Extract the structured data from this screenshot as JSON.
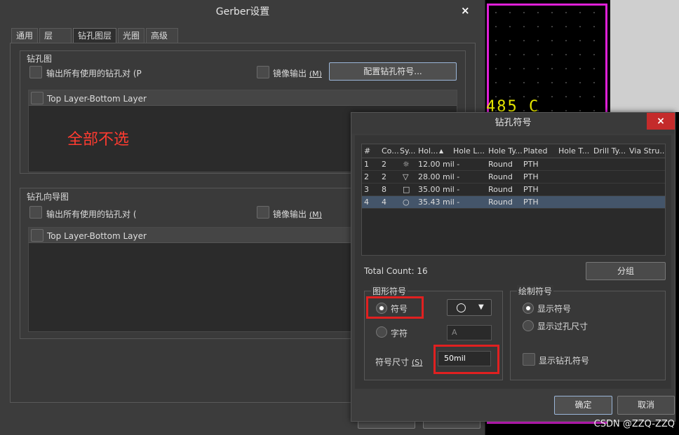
{
  "gerber": {
    "title": "Gerber设置",
    "close_glyph": "×",
    "tabs": [
      "通用",
      "层",
      "钻孔图层",
      "光圈",
      "高级"
    ],
    "drill_drawing": {
      "label": "钻孔图",
      "output_all": "输出所有使用的钻孔对 (P",
      "mirror": "镜像输出",
      "mirror_key": "(M)",
      "config_button": "配置钻孔符号...",
      "layer_pair": "Top Layer-Bottom Layer"
    },
    "annotation": "全部不选",
    "drill_guide": {
      "label": "钻孔向导图",
      "output_all": "输出所有使用的钻孔对 (",
      "mirror": "镜像输出",
      "mirror_key": "(M)",
      "layer_pair": "Top Layer-Bottom Layer"
    }
  },
  "pcb": {
    "text": "485 C"
  },
  "drill_symbols_dialog": {
    "title": "钻孔符号",
    "close_glyph": "×",
    "columns": [
      "#",
      "Co...",
      "Sy...",
      "Hol...",
      "Hole L...",
      "Hole Ty...",
      "Plated",
      "Hole T...",
      "Drill Ty...",
      "Via Stru..."
    ],
    "rows": [
      {
        "num": "1",
        "count": "2",
        "symbol": "☼",
        "hole": "12.00 mil -",
        "hole_type": "Round",
        "plated": "PTH"
      },
      {
        "num": "2",
        "count": "2",
        "symbol": "▽",
        "hole": "28.00 mil -",
        "hole_type": "Round",
        "plated": "PTH"
      },
      {
        "num": "3",
        "count": "8",
        "symbol": "□",
        "hole": "35.00 mil -",
        "hole_type": "Round",
        "plated": "PTH"
      },
      {
        "num": "4",
        "count": "4",
        "symbol": "○",
        "hole": "35.43 mil -",
        "hole_type": "Round",
        "plated": "PTH"
      }
    ],
    "selected_row": 4,
    "total_count": "Total Count: 16",
    "group_button": "分组",
    "graphic_symbol": {
      "label": "图形符号",
      "symbol_option": "符号",
      "char_option": "字符",
      "selected": "符号",
      "symbol_value": "○",
      "char_value": "A",
      "size_label": "符号尺寸",
      "size_key": "(S)",
      "size_value": "50mil"
    },
    "draw_symbol": {
      "label": "绘制符号",
      "show_symbol": "显示符号",
      "show_hole_size": "显示过孔尺寸",
      "show_drill_symbol": "显示钻孔符号",
      "selected": "显示符号"
    },
    "ok_button": "确定",
    "cancel_button": "取消"
  },
  "watermark": "CSDN @ZZQ-ZZQ",
  "colors": {
    "accent_red": "#e02020",
    "selection": "#44556a",
    "pcb_magenta": "#e020d8",
    "pcb_yellow": "#e8e800"
  }
}
